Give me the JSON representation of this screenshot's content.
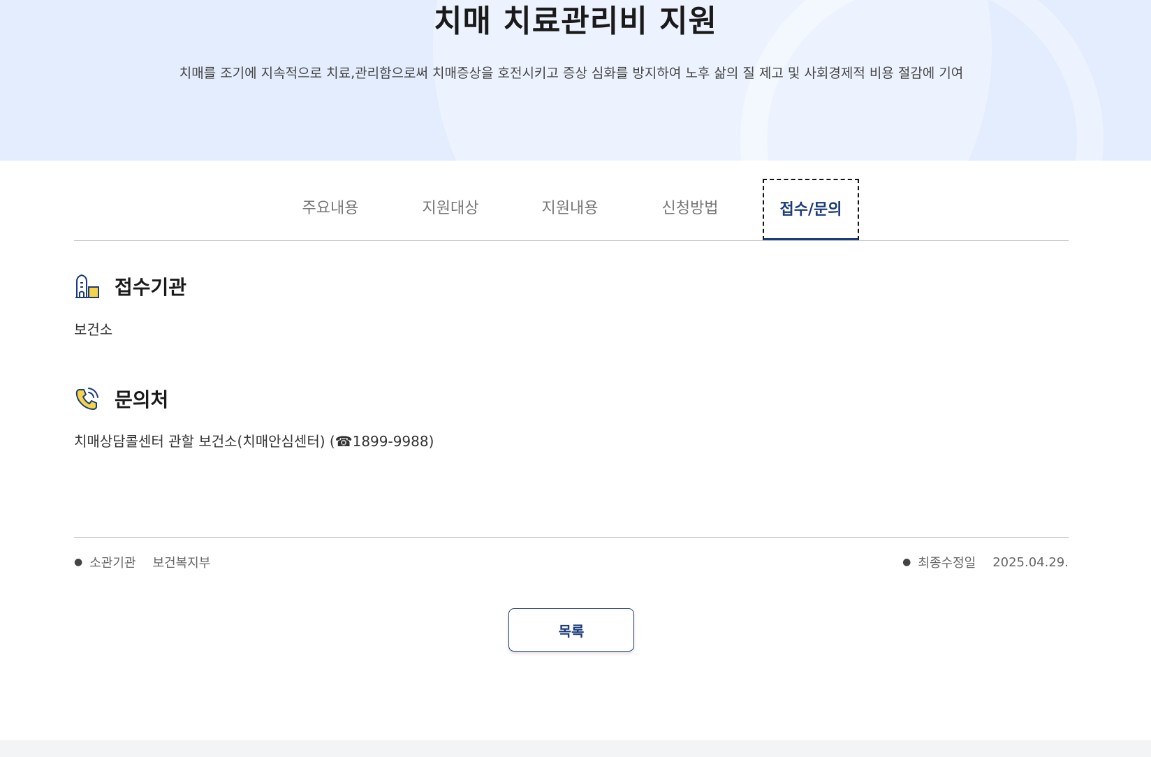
{
  "hero": {
    "title": "치매 치료관리비 지원",
    "description": "치매를 조기에 지속적으로 치료,관리함으로써 치매증상을 호전시키고 증상 심화를 방지하여 노후 삶의 질 제고 및 사회경제적 비용 절감에 기여"
  },
  "tabs": [
    {
      "label": "주요내용",
      "active": false
    },
    {
      "label": "지원대상",
      "active": false
    },
    {
      "label": "지원내용",
      "active": false
    },
    {
      "label": "신청방법",
      "active": false
    },
    {
      "label": "접수/문의",
      "active": true
    }
  ],
  "sections": {
    "reception": {
      "icon": "building-icon",
      "title": "접수기관",
      "body": "보건소"
    },
    "contact": {
      "icon": "phone-icon",
      "title": "문의처",
      "body": "치매상담콜센터 관할 보건소(치매안심센터) (☎1899-9988)"
    }
  },
  "meta": {
    "agency_label": "소관기관",
    "agency_value": "보건복지부",
    "updated_label": "최종수정일",
    "updated_value": "2025.04.29."
  },
  "list_button": "목록",
  "colors": {
    "hero_bg": "#e4edfd",
    "accent": "#1b3c7a",
    "icon_yellow": "#f5d547"
  }
}
